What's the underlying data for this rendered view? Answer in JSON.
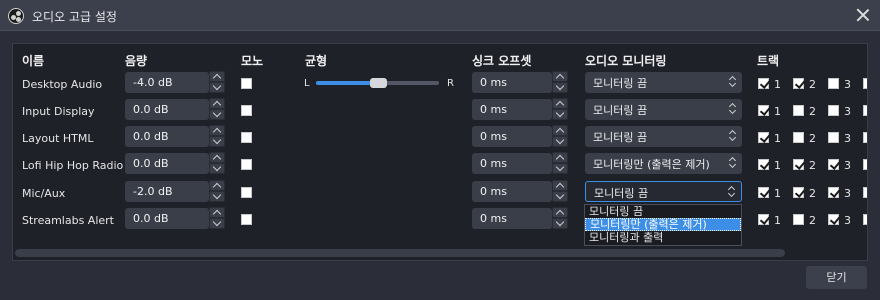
{
  "window": {
    "title": "오디오 고급 설정",
    "close_button": "닫기"
  },
  "columns": {
    "name": "이름",
    "volume": "음량",
    "mono": "모노",
    "balance": "균형",
    "sync_offset": "싱크 오프셋",
    "monitoring": "오디오 모니터링",
    "tracks": "트랙"
  },
  "balance_labels": {
    "left": "L",
    "right": "R"
  },
  "sources": [
    {
      "name": "Desktop Audio",
      "volume": "-4.0 dB",
      "mono": false,
      "balance": 0.5,
      "sync_offset": "0 ms",
      "monitoring": "모니터링 끔",
      "tracks": [
        true,
        true,
        false
      ]
    },
    {
      "name": "Input Display",
      "volume": "0.0 dB",
      "mono": false,
      "sync_offset": "0 ms",
      "monitoring": "모니터링 끔",
      "tracks": [
        true,
        false,
        false
      ]
    },
    {
      "name": "Layout HTML",
      "volume": "0.0 dB",
      "mono": false,
      "sync_offset": "0 ms",
      "monitoring": "모니터링 끔",
      "tracks": [
        true,
        false,
        false
      ]
    },
    {
      "name": "Lofi Hip Hop Radio",
      "volume": "0.0 dB",
      "mono": false,
      "sync_offset": "0 ms",
      "monitoring": "모니터링만 (출력은 제거)",
      "tracks": [
        true,
        true,
        true
      ]
    },
    {
      "name": "Mic/Aux",
      "volume": "-2.0 dB",
      "mono": false,
      "sync_offset": "0 ms",
      "monitoring": "모니터링 끔",
      "tracks": [
        true,
        true,
        true
      ]
    },
    {
      "name": "Streamlabs Alert",
      "volume": "0.0 dB",
      "mono": false,
      "sync_offset": "0 ms",
      "monitoring": "",
      "tracks": [
        true,
        false,
        true
      ]
    }
  ],
  "track_labels": [
    "1",
    "2",
    "3"
  ],
  "monitoring_options": [
    "모니터링 끔",
    "모니터링만 (출력은 제거)",
    "모니터링과 출력"
  ],
  "monitoring_dropdown_selected": 1,
  "colors": {
    "accent": "#3d8ee6",
    "panel": "#1f2128",
    "window": "#2b2e38",
    "control": "#3a3e49"
  }
}
